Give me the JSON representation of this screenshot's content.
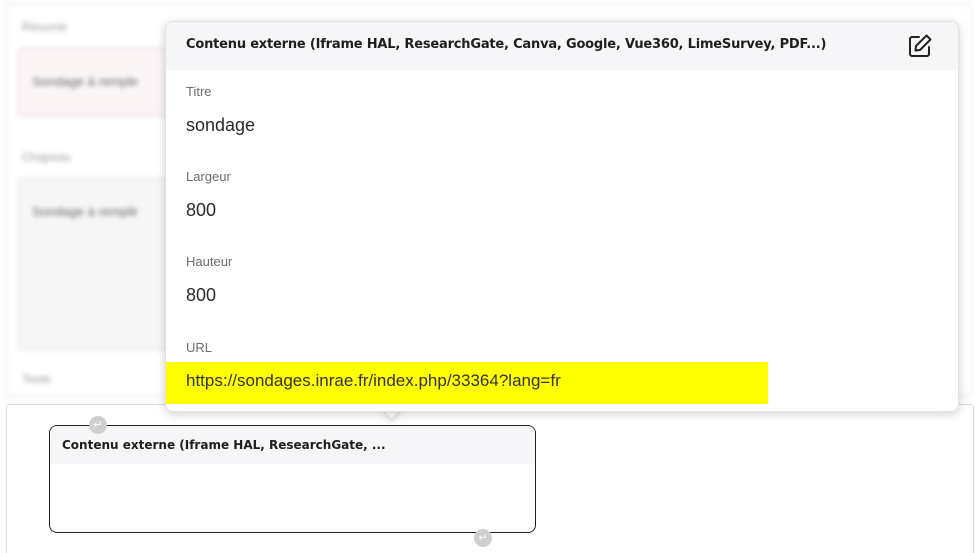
{
  "background": {
    "field1_label": "Résumé",
    "field1_value": "Sondage à remplir",
    "field2_label": "Chapeau",
    "field2_value": "Sondage à remplir",
    "field3_label": "Texte"
  },
  "editor": {
    "embed_block_title": "Contenu externe (Iframe HAL, ResearchGate, ...",
    "return_glyph": "↵"
  },
  "popup": {
    "title": "Contenu externe (Iframe HAL, ResearchGate, Canva, Google, Vue360, LimeSurvey, PDF...)",
    "edit_icon": "edit-icon",
    "fields": {
      "titre_label": "Titre",
      "titre_value": "sondage",
      "largeur_label": "Largeur",
      "largeur_value": "800",
      "hauteur_label": "Hauteur",
      "hauteur_value": "800",
      "url_label": "URL",
      "url_value": "https://sondages.inrae.fr/index.php/33364?lang=fr"
    }
  },
  "colors": {
    "highlight": "#ffff00",
    "header_bg": "#f6f6f8"
  }
}
